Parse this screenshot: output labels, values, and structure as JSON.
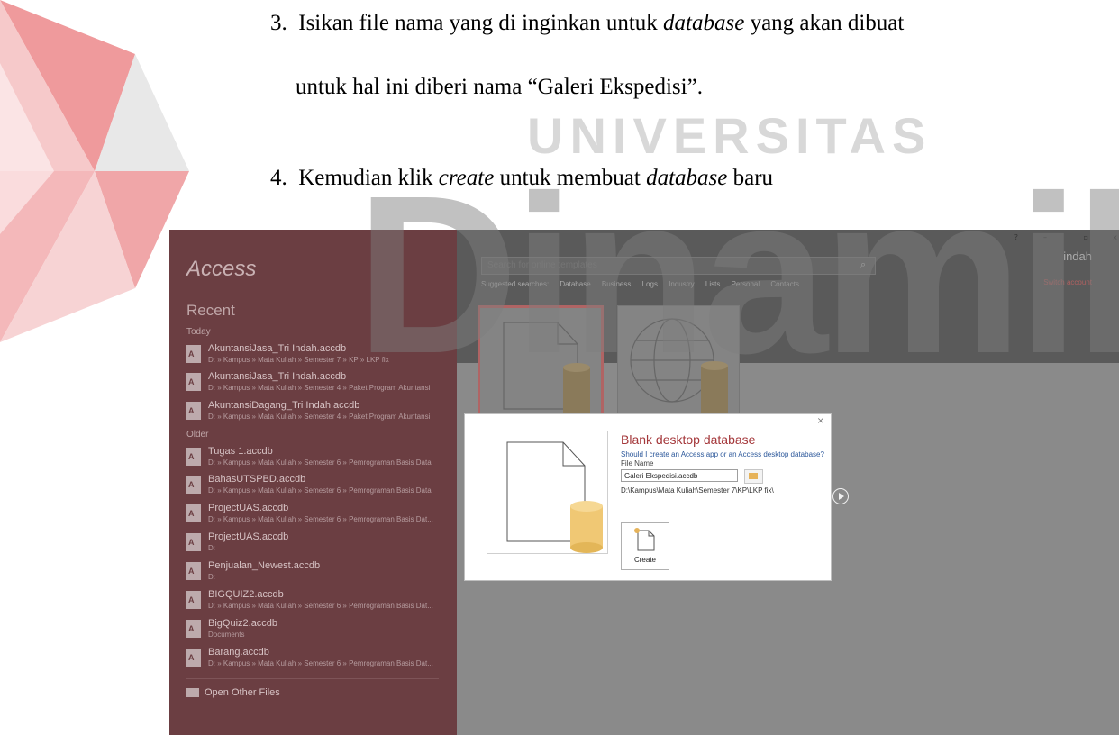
{
  "document": {
    "step3_number": "3.",
    "step3_text_a": "Isikan file nama yang di inginkan untuk ",
    "step3_italic": "database",
    "step3_text_b": " yang akan dibuat",
    "step3_line2": "untuk hal ini diberi nama “Galeri Ekspedisi”.",
    "step4_number": "4.",
    "step4_text_a": "Kemudian klik ",
    "step4_italic_a": "create",
    "step4_text_b": " untuk membuat ",
    "step4_italic_b": "database",
    "step4_text_c": " baru"
  },
  "watermark": {
    "line1": "UNIVERSITAS",
    "line2": "Dinamika",
    "colors": {
      "red": "#e0262c",
      "grey": "#b3b3b3"
    }
  },
  "screenshot": {
    "sidebar": {
      "app_title": "Access",
      "recent_label": "Recent",
      "group_today": "Today",
      "group_older": "Older",
      "files_today": [
        {
          "name": "AkuntansiJasa_Tri Indah.accdb",
          "path": "D: » Kampus » Mata Kuliah » Semester 7 » KP » LKP fix"
        },
        {
          "name": "AkuntansiJasa_Tri Indah.accdb",
          "path": "D: » Kampus » Mata Kuliah » Semester 4 » Paket Program Akuntansi"
        },
        {
          "name": "AkuntansiDagang_Tri Indah.accdb",
          "path": "D: » Kampus » Mata Kuliah » Semester 4 » Paket Program Akuntansi"
        }
      ],
      "files_older": [
        {
          "name": "Tugas 1.accdb",
          "path": "D: » Kampus » Mata Kuliah » Semester 6 » Pemrograman Basis Data"
        },
        {
          "name": "BahasUTSPBD.accdb",
          "path": "D: » Kampus » Mata Kuliah » Semester 6 » Pemrograman Basis Data"
        },
        {
          "name": "ProjectUAS.accdb",
          "path": "D: » Kampus » Mata Kuliah » Semester 6 » Pemrograman Basis Dat..."
        },
        {
          "name": "ProjectUAS.accdb",
          "path": "D:"
        },
        {
          "name": "Penjualan_Newest.accdb",
          "path": "D:"
        },
        {
          "name": "BIGQUIZ2.accdb",
          "path": "D: » Kampus » Mata Kuliah » Semester 6 » Pemrograman Basis Dat..."
        },
        {
          "name": "BigQuiz2.accdb",
          "path": "Documents"
        },
        {
          "name": "Barang.accdb",
          "path": "D: » Kampus » Mata Kuliah » Semester 6 » Pemrograman Basis Dat..."
        }
      ],
      "open_other": "Open Other Files"
    },
    "search_placeholder": "Search for online templates",
    "search_icon": "search-icon",
    "suggested": [
      "Suggested searches:",
      "Database",
      "Business",
      "Logs",
      "Industry",
      "Lists",
      "Personal",
      "Contacts"
    ],
    "user": "indah",
    "switch_account": "Switch account",
    "window_controls": [
      "?",
      "–",
      "▫",
      "x"
    ],
    "dialog": {
      "title": "Blank desktop database",
      "question": "Should I create an Access app or an Access desktop database?",
      "file_name_label": "File Name",
      "file_name_value": "Galeri Ekspedisi.accdb",
      "path": "D:\\Kampus\\Mata Kuliah\\Semester 7\\KP\\LKP fix\\",
      "create_label": "Create",
      "close_glyph": "×",
      "accent": "#a4373a"
    }
  }
}
